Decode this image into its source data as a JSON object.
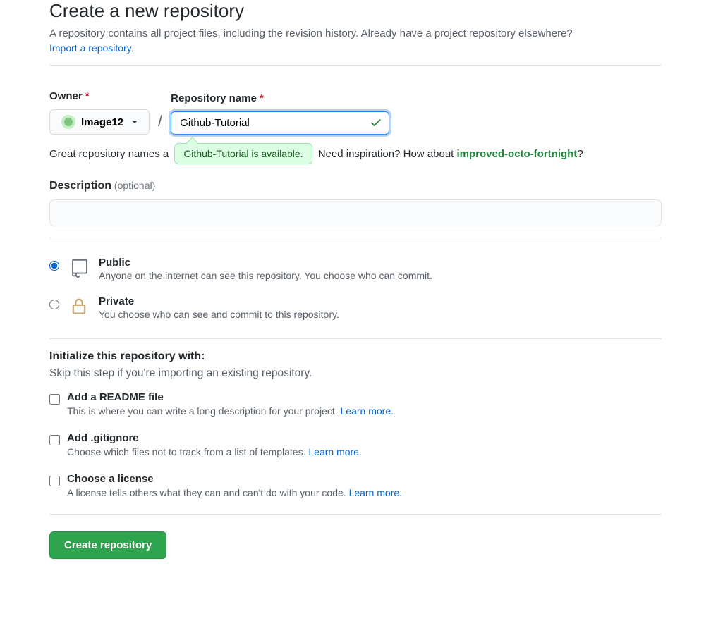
{
  "header": {
    "title": "Create a new repository",
    "subtitle_prefix": "A repository contains all project files, including the revision history. Already have a project repository elsewhere? ",
    "import_link": "Import a repository."
  },
  "owner": {
    "label": "Owner",
    "name": "Image12"
  },
  "repo": {
    "label": "Repository name",
    "value": "Github-Tutorial"
  },
  "availability": {
    "tooltip": "Github-Tutorial is available."
  },
  "hint": {
    "prefix": "Great repository names a",
    "suffix_before": "Need inspiration? How about ",
    "suggestion": "improved-octo-fortnight",
    "suffix_after": "?"
  },
  "description": {
    "label": "Description",
    "optional": "(optional)",
    "value": ""
  },
  "visibility": {
    "public": {
      "title": "Public",
      "desc": "Anyone on the internet can see this repository. You choose who can commit."
    },
    "private": {
      "title": "Private",
      "desc": "You choose who can see and commit to this repository."
    }
  },
  "initialize": {
    "heading": "Initialize this repository with:",
    "subtext": "Skip this step if you're importing an existing repository.",
    "readme": {
      "title": "Add a README file",
      "desc": "This is where you can write a long description for your project. ",
      "link": "Learn more."
    },
    "gitignore": {
      "title": "Add .gitignore",
      "desc": "Choose which files not to track from a list of templates. ",
      "link": "Learn more."
    },
    "license": {
      "title": "Choose a license",
      "desc": "A license tells others what they can and can't do with your code. ",
      "link": "Learn more."
    }
  },
  "submit": {
    "label": "Create repository"
  }
}
